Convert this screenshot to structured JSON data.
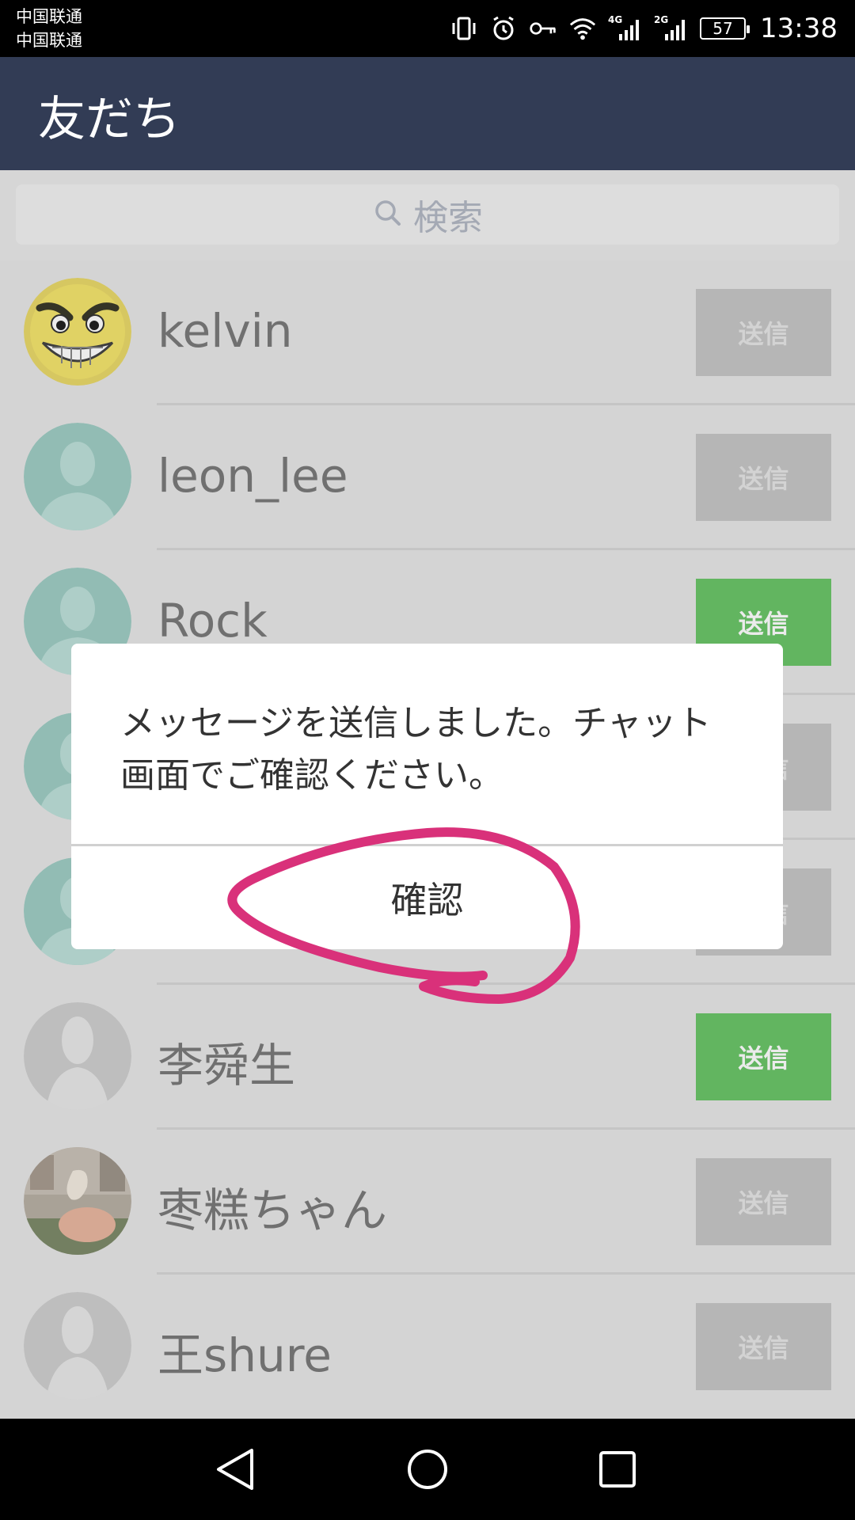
{
  "status_bar": {
    "carrier_1": "中国联通",
    "carrier_2": "中国联通",
    "net_1": "4G",
    "net_2": "2G",
    "battery": "57",
    "time": "13:38"
  },
  "header": {
    "title": "友だち"
  },
  "search": {
    "placeholder": "検索"
  },
  "friends": [
    {
      "name": "kelvin",
      "send_label": "送信",
      "send_active": false,
      "avatar": "grinning-face"
    },
    {
      "name": "leon_lee",
      "send_label": "送信",
      "send_active": false,
      "avatar": "default-silhouette"
    },
    {
      "name": "Rock",
      "send_label": "送信",
      "send_active": true,
      "avatar": "default-silhouette"
    },
    {
      "name": "",
      "send_label": "送信",
      "send_active": false,
      "avatar": "default-silhouette"
    },
    {
      "name": "",
      "send_label": "送信",
      "send_active": false,
      "avatar": "default-silhouette"
    },
    {
      "name": "李舜生",
      "send_label": "送信",
      "send_active": true,
      "avatar": "gray-silhouette"
    },
    {
      "name": "枣糕ちゃん",
      "send_label": "送信",
      "send_active": false,
      "avatar": "photo"
    },
    {
      "name": "王shure",
      "send_label": "送信",
      "send_active": false,
      "avatar": "gray-silhouette"
    }
  ],
  "dialog": {
    "message": "メッセージを送信しました。チャット画面でご確認ください。",
    "confirm_label": "確認"
  },
  "colors": {
    "header_bg": "#323c55",
    "send_active": "#6bc569",
    "send_inactive": "#c6c6c6",
    "annotation": "#d9317a"
  }
}
